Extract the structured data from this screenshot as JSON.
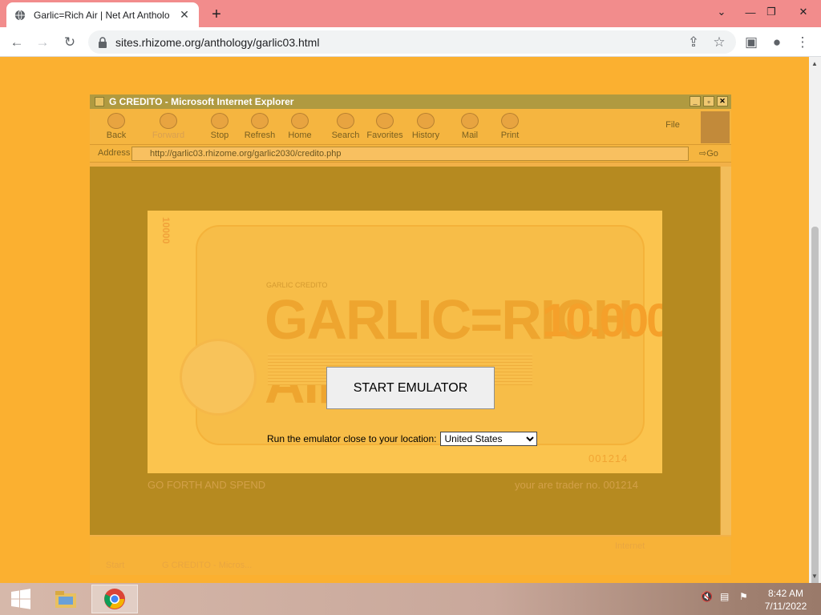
{
  "browser": {
    "tab_title": "Garlic=Rich Air | Net Art Antholo",
    "url": "sites.rhizome.org/anthology/garlic03.html"
  },
  "ie": {
    "window_title": "G CREDITO - Microsoft Internet Explorer",
    "toolbar": {
      "back": "Back",
      "forward": "Forward",
      "stop": "Stop",
      "refresh": "Refresh",
      "home": "Home",
      "search": "Search",
      "favorites": "Favorites",
      "history": "History",
      "mail": "Mail",
      "print": "Print",
      "file": "File"
    },
    "address_label": "Address",
    "address_url": "http://garlic03.rhizome.org/garlic2030/credito.php",
    "go_label": "Go",
    "status_internet": "Internet",
    "taskbar_start": "Start",
    "taskbar_item": "G CREDITO - Micros..."
  },
  "cheque": {
    "denomination": "10000",
    "issuer_line": "GARLIC CREDITO",
    "big_text": "GARLIC=RICH AIR",
    "amount": "10.000.",
    "serial": "001214"
  },
  "emulator": {
    "start_button": "START EMULATOR",
    "location_label": "Run the emulator close to your location:",
    "location_selected": "United States"
  },
  "page_footer": {
    "left": "GO FORTH AND SPEND",
    "right": "your are trader no. 001214"
  },
  "taskbar": {
    "time": "8:42 AM",
    "date": "7/11/2022"
  }
}
